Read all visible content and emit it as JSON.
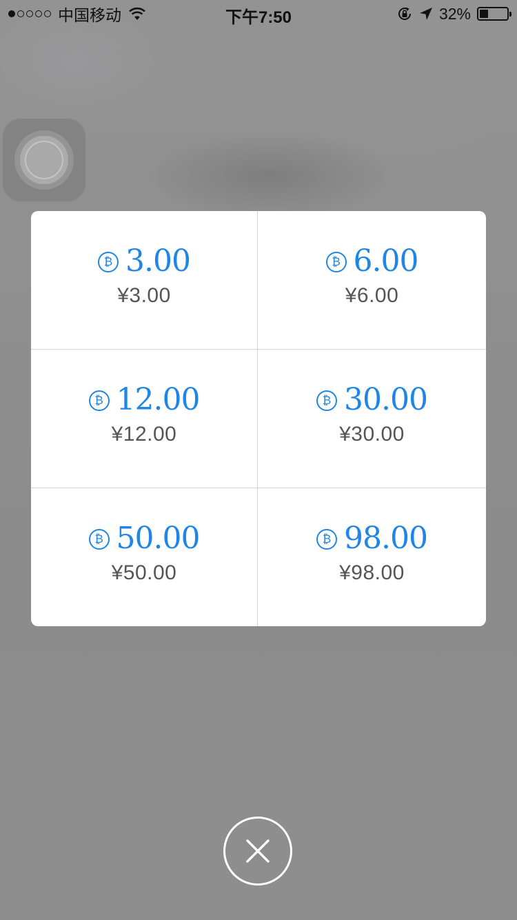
{
  "status_bar": {
    "signal_total": 5,
    "signal_strength": 1,
    "carrier": "中国移动",
    "time": "下午7:50",
    "battery_percent_label": "32%",
    "battery_level": 0.32,
    "icons": [
      "signal-dots-icon",
      "wifi-icon",
      "rotation-lock-icon",
      "location-arrow-icon",
      "battery-icon"
    ]
  },
  "assistive_touch": {
    "icon": "assistive-touch-icon"
  },
  "recharge": {
    "coin_symbol": "₿",
    "coin_icon": "coin-icon",
    "accent_color": "#1f86e8",
    "options": [
      {
        "coins": "3.00",
        "price": "¥3.00"
      },
      {
        "coins": "6.00",
        "price": "¥6.00"
      },
      {
        "coins": "12.00",
        "price": "¥12.00"
      },
      {
        "coins": "30.00",
        "price": "¥30.00"
      },
      {
        "coins": "50.00",
        "price": "¥50.00"
      },
      {
        "coins": "98.00",
        "price": "¥98.00"
      }
    ]
  },
  "close_button": {
    "icon": "close-icon"
  }
}
